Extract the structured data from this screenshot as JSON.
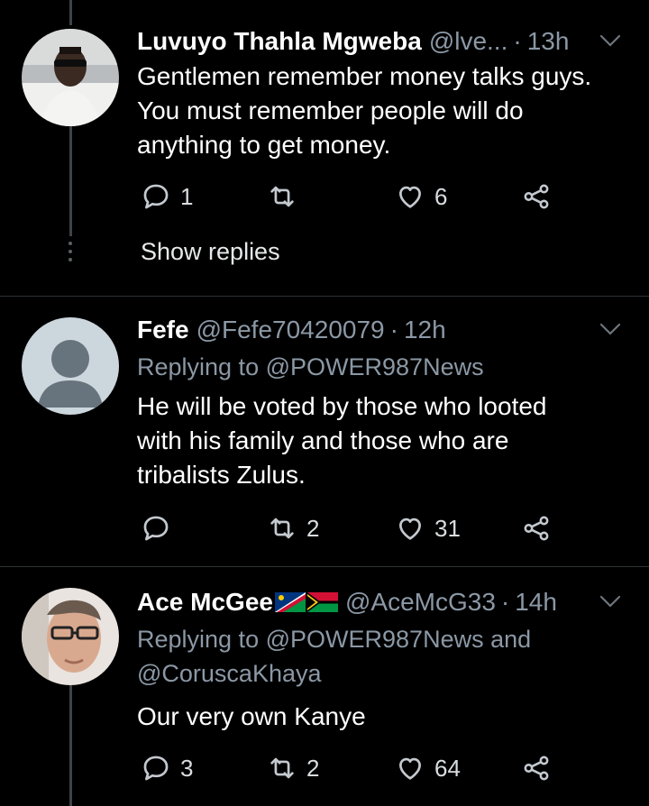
{
  "tweets": [
    {
      "name": "Luvuyo Thahla Mgweba",
      "handle": "@lve...",
      "time": "13h",
      "replying_prefix": "",
      "replying_mentions": "",
      "body_lines": [
        "Gentlemen remember money talks guys.",
        "You must remember people will do",
        "anything to get money."
      ],
      "actions": {
        "reply": "1",
        "retweet": "",
        "like": "6"
      },
      "avatar": "photo-man-sunglasses"
    },
    {
      "name": "Fefe",
      "handle": "@Fefe70420079",
      "time": "12h",
      "replying_prefix": "Replying to",
      "replying_mentions": "@POWER987News",
      "body_lines": [
        "He will be voted by those who looted",
        "with his family and those who are",
        "tribalists Zulus."
      ],
      "actions": {
        "reply": "",
        "retweet": "2",
        "like": "31"
      },
      "avatar": "default-avatar"
    },
    {
      "name": "Ace McGee",
      "handle": "@AceMcG33",
      "time": "14h",
      "replying_prefix": "Replying to",
      "replying_mentions": "@POWER987News and",
      "replying_line2": "@CoruscaKhaya",
      "body_lines": [
        "Our very own Kanye"
      ],
      "actions": {
        "reply": "3",
        "retweet": "2",
        "like": "64"
      },
      "avatar": "photo-man-glasses",
      "flags": [
        "namibia-flag",
        "vanuatu-flag"
      ]
    }
  ],
  "show_replies_label": "Show replies",
  "colors": {
    "background": "#000000",
    "secondary_text": "#8b98a5",
    "divider": "#2f3336",
    "icon": "#8b98a5"
  }
}
